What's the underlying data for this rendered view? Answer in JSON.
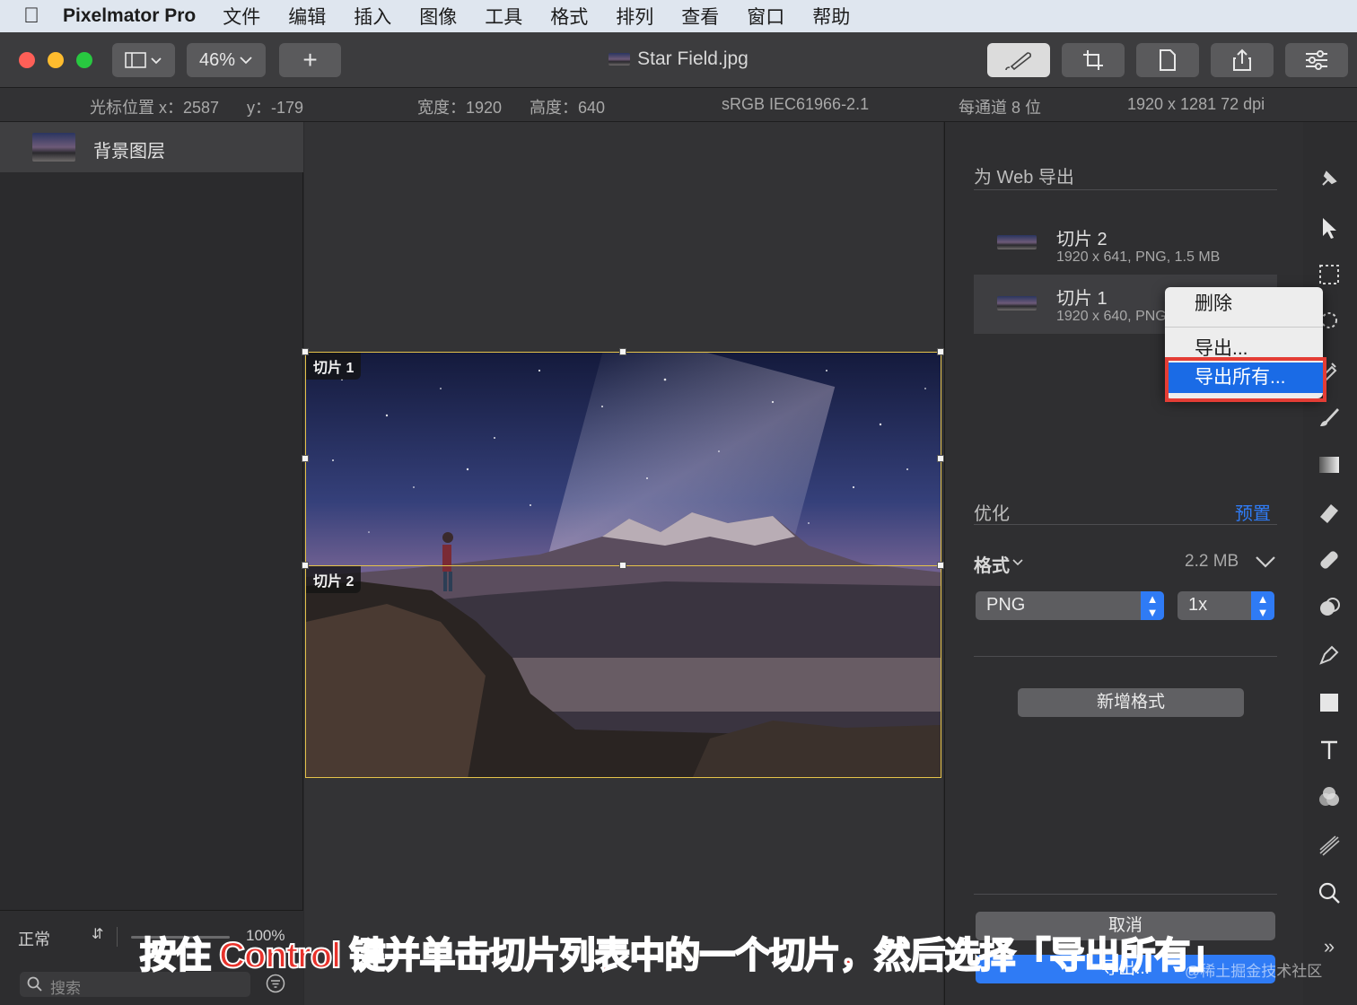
{
  "menubar": {
    "app_name": "Pixelmator Pro",
    "items": [
      "文件",
      "编辑",
      "插入",
      "图像",
      "工具",
      "格式",
      "排列",
      "查看",
      "窗口",
      "帮助"
    ]
  },
  "toolbar": {
    "zoom": "46%",
    "add_symbol": "+",
    "document_title": "Star Field.jpg"
  },
  "infobar": {
    "cursor_x": "光标位置 x：2587",
    "cursor_y": "y：-179",
    "width": "宽度：1920",
    "height": "高度：640",
    "profile": "sRGB IEC61966-2.1",
    "depth": "每通道 8 位",
    "resolution": "1920 x 1281 72 dpi"
  },
  "layers": {
    "items": [
      {
        "label": "背景图层"
      }
    ],
    "blend_mode": "正常",
    "opacity": "100%",
    "search_placeholder": "搜索"
  },
  "canvas": {
    "slice1_label": "切片 1",
    "slice2_label": "切片 2"
  },
  "export_panel": {
    "title": "为 Web 导出",
    "slices": [
      {
        "name": "切片 2",
        "info": "1920 x 641, PNG, 1.5 MB"
      },
      {
        "name": "切片 1",
        "info": "1920 x 640, PNG"
      }
    ],
    "optimize_label": "优化",
    "presets_link": "预置",
    "format_label": "格式",
    "file_size": "2.2 MB",
    "format_value": "PNG",
    "scale_value": "1x",
    "add_format_button": "新增格式",
    "cancel_button": "取消",
    "export_button": "导出..."
  },
  "context_menu": {
    "items": [
      "删除",
      "导出...",
      "导出所有..."
    ]
  },
  "overlay": {
    "caption": "按住 Control 键并单击切片列表中的一个切片，然后选择「导出所有」",
    "watermark": "@稀土掘金技术社区"
  },
  "colors": {
    "accent": "#2f7bf5",
    "highlight_border": "#e43d35",
    "slice_border": "#e5c34a",
    "caption_red": "#e8322b"
  },
  "icons": {
    "tools": [
      "pin-icon",
      "arrow-icon",
      "marquee-icon",
      "lasso-icon",
      "eyedropper-icon",
      "brush-icon",
      "gradient-icon",
      "eraser-icon",
      "repair-icon",
      "clone-icon",
      "pen-icon",
      "shape-icon",
      "text-icon",
      "color-adjust-icon",
      "effects-icon",
      "zoom-icon",
      "more-icon"
    ]
  }
}
